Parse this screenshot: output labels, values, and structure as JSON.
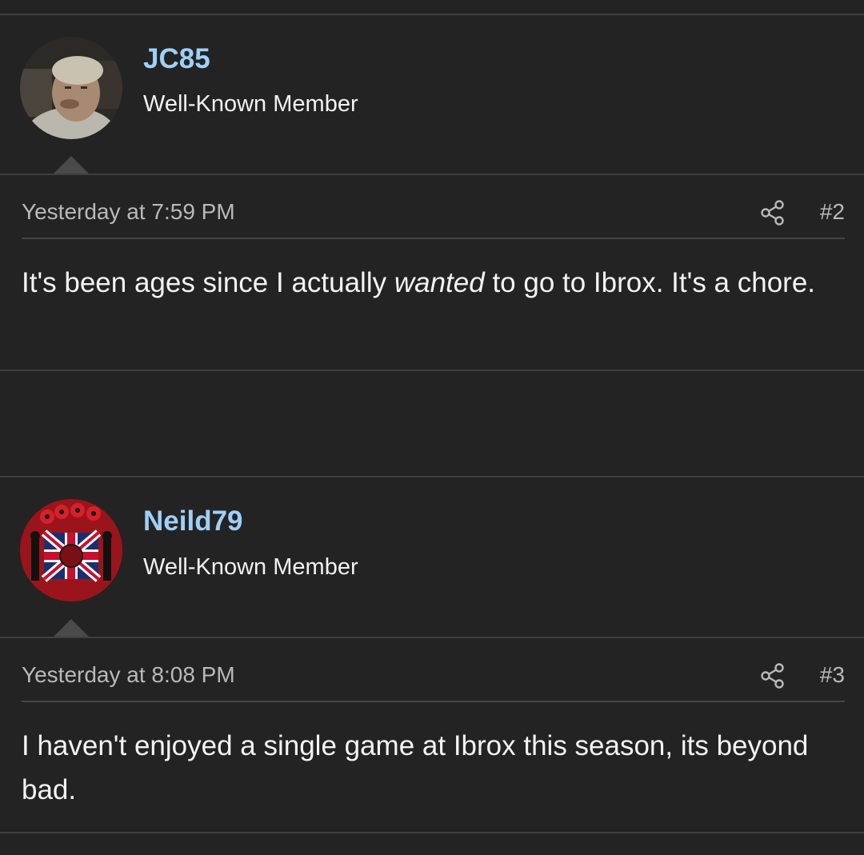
{
  "posts": [
    {
      "username": "JC85",
      "user_title": "Well-Known Member",
      "timestamp": "Yesterday at 7:59 PM",
      "post_number": "#2",
      "body": {
        "before": "It's been ages since I actually ",
        "emphasis": "wanted",
        "after": " to go to Ibrox. It's a chore."
      },
      "share_icon": "share-icon",
      "avatar": "user-photo-avatar"
    },
    {
      "username": "Neild79",
      "user_title": "Well-Known Member",
      "timestamp": "Yesterday at 8:08 PM",
      "post_number": "#3",
      "body": {
        "text": "I haven't enjoyed a single game at Ibrox this season, its beyond bad."
      },
      "share_icon": "share-icon",
      "avatar": "union-flag-poppy-avatar"
    }
  ],
  "colors": {
    "background": "#232323",
    "username": "#9fd0f7",
    "divider": "#3e3e3e",
    "muted_text": "#b9b9b9"
  }
}
